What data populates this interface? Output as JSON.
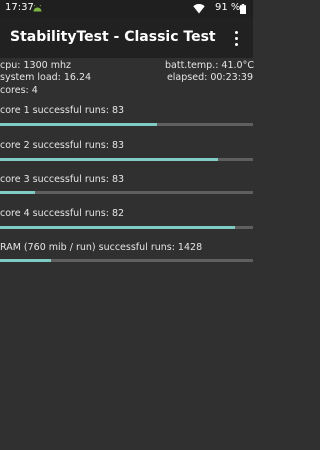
{
  "status_bar": {
    "time": "17:37",
    "battery_pct": "91 %",
    "icons": [
      "android-notification-icon",
      "wifi-icon",
      "battery-icon"
    ]
  },
  "app_bar": {
    "title": "StabilityTest - Classic Test",
    "menu_icon": "overflow-menu-icon"
  },
  "info": {
    "cpu": "cpu: 1300 mhz",
    "batt_temp": "batt.temp.: 41.0°C",
    "system_load": "system load: 16.24",
    "elapsed": "elapsed: 00:23:39",
    "cores": "cores: 4"
  },
  "cores": [
    {
      "label": "core 1 successful runs: 83",
      "progress": 0.62
    },
    {
      "label": "core 2 successful runs: 83",
      "progress": 0.86
    },
    {
      "label": "core 3 successful runs: 83",
      "progress": 0.14
    },
    {
      "label": "core 4 successful runs: 82",
      "progress": 0.93
    }
  ],
  "ram": {
    "label": "RAM (760 mib / run) successful runs: 1428",
    "progress": 0.2
  },
  "colors": {
    "background": "#303030",
    "app_bar": "#212121",
    "status_bar": "#1f1f1f",
    "progress_fill": "#80cbc4",
    "progress_track": "#5f5f5f"
  }
}
